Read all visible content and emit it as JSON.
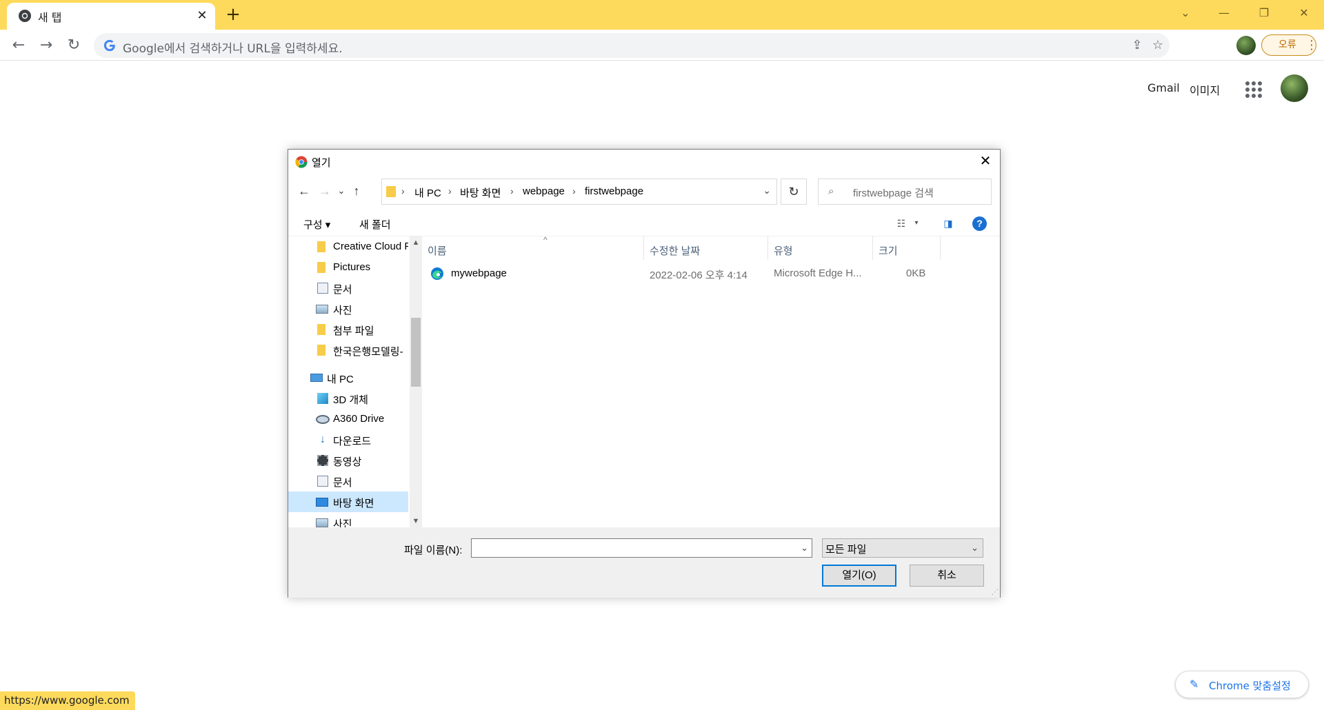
{
  "browser": {
    "tab_title": "새 탭",
    "omnibox_placeholder": "Google에서 검색하거나 URL을 입력하세요.",
    "profile_error_label": "오류",
    "accent_color": "#fdda5c"
  },
  "google": {
    "links": {
      "gmail": "Gmail",
      "images": "이미지"
    }
  },
  "dialog": {
    "title": "열기",
    "breadcrumb": [
      "내 PC",
      "바탕 화면",
      "webpage",
      "firstwebpage"
    ],
    "search_placeholder": "firstwebpage 검색",
    "commands": {
      "organize": "구성",
      "new_folder": "새 폴더"
    },
    "nav_items": [
      {
        "label": "Creative Cloud F",
        "icon": "folder-icon"
      },
      {
        "label": "Pictures",
        "icon": "folder-icon"
      },
      {
        "label": "문서",
        "icon": "document-icon"
      },
      {
        "label": "사진",
        "icon": "image-icon"
      },
      {
        "label": "첨부 파일",
        "icon": "folder-icon"
      },
      {
        "label": "한국은행모델링-",
        "icon": "folder-icon"
      },
      {
        "label": "내 PC",
        "icon": "pc-icon"
      },
      {
        "label": "3D 개체",
        "icon": "cube-icon"
      },
      {
        "label": "A360 Drive",
        "icon": "drive-icon"
      },
      {
        "label": "다운로드",
        "icon": "download-icon"
      },
      {
        "label": "동영상",
        "icon": "video-icon"
      },
      {
        "label": "문서",
        "icon": "document-icon"
      },
      {
        "label": "바탕 화면",
        "icon": "desktop-icon",
        "selected": true
      },
      {
        "label": "사진",
        "icon": "image-icon"
      }
    ],
    "columns": {
      "name": "이름",
      "modified": "수정한 날짜",
      "type": "유형",
      "size": "크기"
    },
    "files": [
      {
        "name": "mywebpage",
        "modified": "2022-02-06 오후 4:14",
        "type": "Microsoft Edge H...",
        "size": "0KB",
        "icon": "edge-icon"
      }
    ],
    "filename_label": "파일 이름(N):",
    "filename_value": "",
    "filter_value": "모든 파일",
    "open_button": "열기(O)",
    "cancel_button": "취소"
  },
  "footer": {
    "status_url": "https://www.google.com",
    "customize_label": "Chrome 맞춤설정"
  }
}
